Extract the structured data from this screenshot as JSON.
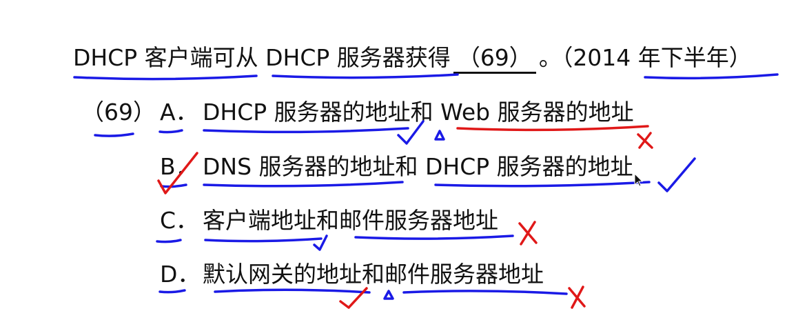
{
  "question": {
    "prefix": "DHCP 客户端可从 DHCP 服务器获得",
    "blank": "（69）",
    "suffix": "。（2014 年下半年）"
  },
  "qnum": "（69）",
  "options": [
    {
      "letter": "A．",
      "text": "DHCP 服务器的地址和 Web 服务器的地址"
    },
    {
      "letter": "B．",
      "text": "DNS 服务器的地址和 DHCP 服务器的地址"
    },
    {
      "letter": "C．",
      "text": "客户端地址和邮件服务器地址"
    },
    {
      "letter": "D．",
      "text": "默认网关的地址和邮件服务器地址"
    }
  ],
  "colors": {
    "blue_ink": "#1a1ae6",
    "red_ink": "#e01818",
    "text": "#111111"
  }
}
